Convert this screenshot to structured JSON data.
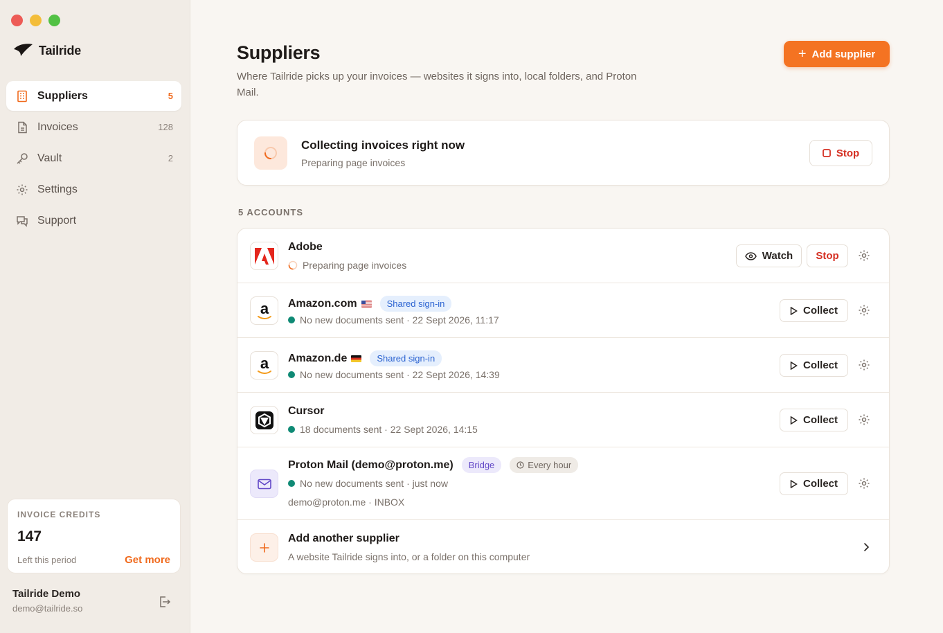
{
  "sidebar": {
    "brand": "Tailride",
    "items": [
      {
        "label": "Suppliers",
        "count": "5"
      },
      {
        "label": "Invoices",
        "count": "128"
      },
      {
        "label": "Vault",
        "count": "2"
      },
      {
        "label": "Settings",
        "count": ""
      },
      {
        "label": "Support",
        "count": ""
      }
    ],
    "credits": {
      "title": "INVOICE CREDITS",
      "value": "147",
      "sub": "Left this period",
      "link": "Get more"
    },
    "user": {
      "name": "Tailride Demo",
      "email": "demo@tailride.so"
    }
  },
  "header": {
    "title": "Suppliers",
    "subtitle": "Where Tailride picks up your invoices — websites it signs into, local folders, and Proton Mail.",
    "add_button": "Add supplier"
  },
  "collecting": {
    "title": "Collecting invoices right now",
    "subtitle": "Preparing page invoices",
    "stop_label": "Stop"
  },
  "accounts_label": "5 ACCOUNTS",
  "accounts": [
    {
      "name": "Adobe",
      "status": "Preparing page invoices",
      "watch_label": "Watch",
      "stop_label": "Stop"
    },
    {
      "name": "Amazon.com",
      "badge": "Shared sign-in",
      "status": "No new documents sent · 22 Sept 2026, 11:17",
      "action": "Collect"
    },
    {
      "name": "Amazon.de",
      "badge": "Shared sign-in",
      "status": "No new documents sent · 22 Sept 2026, 14:39",
      "action": "Collect"
    },
    {
      "name": "Cursor",
      "status": "18 documents sent · 22 Sept 2026, 14:15",
      "action": "Collect"
    },
    {
      "name": "Proton Mail (demo@proton.me)",
      "badge": "Bridge",
      "schedule": "Every hour",
      "status": "No new documents sent · just now",
      "detail": "demo@proton.me · INBOX",
      "action": "Collect"
    }
  ],
  "add_another": {
    "title": "Add another supplier",
    "subtitle": "A website Tailride signs into, or a folder on this computer"
  },
  "colors": {
    "accent": "#f47322",
    "danger": "#d52f22",
    "success": "#0f8a75"
  }
}
